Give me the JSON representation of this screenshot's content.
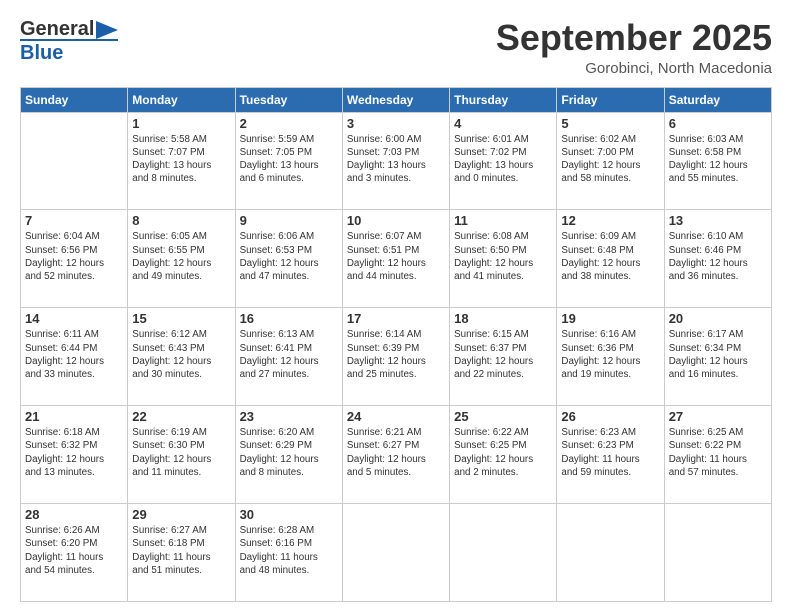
{
  "header": {
    "logo_general": "General",
    "logo_blue": "Blue",
    "month_title": "September 2025",
    "subtitle": "Gorobinci, North Macedonia"
  },
  "weekdays": [
    "Sunday",
    "Monday",
    "Tuesday",
    "Wednesday",
    "Thursday",
    "Friday",
    "Saturday"
  ],
  "weeks": [
    [
      {
        "day": "",
        "info": ""
      },
      {
        "day": "1",
        "info": "Sunrise: 5:58 AM\nSunset: 7:07 PM\nDaylight: 13 hours\nand 8 minutes."
      },
      {
        "day": "2",
        "info": "Sunrise: 5:59 AM\nSunset: 7:05 PM\nDaylight: 13 hours\nand 6 minutes."
      },
      {
        "day": "3",
        "info": "Sunrise: 6:00 AM\nSunset: 7:03 PM\nDaylight: 13 hours\nand 3 minutes."
      },
      {
        "day": "4",
        "info": "Sunrise: 6:01 AM\nSunset: 7:02 PM\nDaylight: 13 hours\nand 0 minutes."
      },
      {
        "day": "5",
        "info": "Sunrise: 6:02 AM\nSunset: 7:00 PM\nDaylight: 12 hours\nand 58 minutes."
      },
      {
        "day": "6",
        "info": "Sunrise: 6:03 AM\nSunset: 6:58 PM\nDaylight: 12 hours\nand 55 minutes."
      }
    ],
    [
      {
        "day": "7",
        "info": "Sunrise: 6:04 AM\nSunset: 6:56 PM\nDaylight: 12 hours\nand 52 minutes."
      },
      {
        "day": "8",
        "info": "Sunrise: 6:05 AM\nSunset: 6:55 PM\nDaylight: 12 hours\nand 49 minutes."
      },
      {
        "day": "9",
        "info": "Sunrise: 6:06 AM\nSunset: 6:53 PM\nDaylight: 12 hours\nand 47 minutes."
      },
      {
        "day": "10",
        "info": "Sunrise: 6:07 AM\nSunset: 6:51 PM\nDaylight: 12 hours\nand 44 minutes."
      },
      {
        "day": "11",
        "info": "Sunrise: 6:08 AM\nSunset: 6:50 PM\nDaylight: 12 hours\nand 41 minutes."
      },
      {
        "day": "12",
        "info": "Sunrise: 6:09 AM\nSunset: 6:48 PM\nDaylight: 12 hours\nand 38 minutes."
      },
      {
        "day": "13",
        "info": "Sunrise: 6:10 AM\nSunset: 6:46 PM\nDaylight: 12 hours\nand 36 minutes."
      }
    ],
    [
      {
        "day": "14",
        "info": "Sunrise: 6:11 AM\nSunset: 6:44 PM\nDaylight: 12 hours\nand 33 minutes."
      },
      {
        "day": "15",
        "info": "Sunrise: 6:12 AM\nSunset: 6:43 PM\nDaylight: 12 hours\nand 30 minutes."
      },
      {
        "day": "16",
        "info": "Sunrise: 6:13 AM\nSunset: 6:41 PM\nDaylight: 12 hours\nand 27 minutes."
      },
      {
        "day": "17",
        "info": "Sunrise: 6:14 AM\nSunset: 6:39 PM\nDaylight: 12 hours\nand 25 minutes."
      },
      {
        "day": "18",
        "info": "Sunrise: 6:15 AM\nSunset: 6:37 PM\nDaylight: 12 hours\nand 22 minutes."
      },
      {
        "day": "19",
        "info": "Sunrise: 6:16 AM\nSunset: 6:36 PM\nDaylight: 12 hours\nand 19 minutes."
      },
      {
        "day": "20",
        "info": "Sunrise: 6:17 AM\nSunset: 6:34 PM\nDaylight: 12 hours\nand 16 minutes."
      }
    ],
    [
      {
        "day": "21",
        "info": "Sunrise: 6:18 AM\nSunset: 6:32 PM\nDaylight: 12 hours\nand 13 minutes."
      },
      {
        "day": "22",
        "info": "Sunrise: 6:19 AM\nSunset: 6:30 PM\nDaylight: 12 hours\nand 11 minutes."
      },
      {
        "day": "23",
        "info": "Sunrise: 6:20 AM\nSunset: 6:29 PM\nDaylight: 12 hours\nand 8 minutes."
      },
      {
        "day": "24",
        "info": "Sunrise: 6:21 AM\nSunset: 6:27 PM\nDaylight: 12 hours\nand 5 minutes."
      },
      {
        "day": "25",
        "info": "Sunrise: 6:22 AM\nSunset: 6:25 PM\nDaylight: 12 hours\nand 2 minutes."
      },
      {
        "day": "26",
        "info": "Sunrise: 6:23 AM\nSunset: 6:23 PM\nDaylight: 11 hours\nand 59 minutes."
      },
      {
        "day": "27",
        "info": "Sunrise: 6:25 AM\nSunset: 6:22 PM\nDaylight: 11 hours\nand 57 minutes."
      }
    ],
    [
      {
        "day": "28",
        "info": "Sunrise: 6:26 AM\nSunset: 6:20 PM\nDaylight: 11 hours\nand 54 minutes."
      },
      {
        "day": "29",
        "info": "Sunrise: 6:27 AM\nSunset: 6:18 PM\nDaylight: 11 hours\nand 51 minutes."
      },
      {
        "day": "30",
        "info": "Sunrise: 6:28 AM\nSunset: 6:16 PM\nDaylight: 11 hours\nand 48 minutes."
      },
      {
        "day": "",
        "info": ""
      },
      {
        "day": "",
        "info": ""
      },
      {
        "day": "",
        "info": ""
      },
      {
        "day": "",
        "info": ""
      }
    ]
  ]
}
